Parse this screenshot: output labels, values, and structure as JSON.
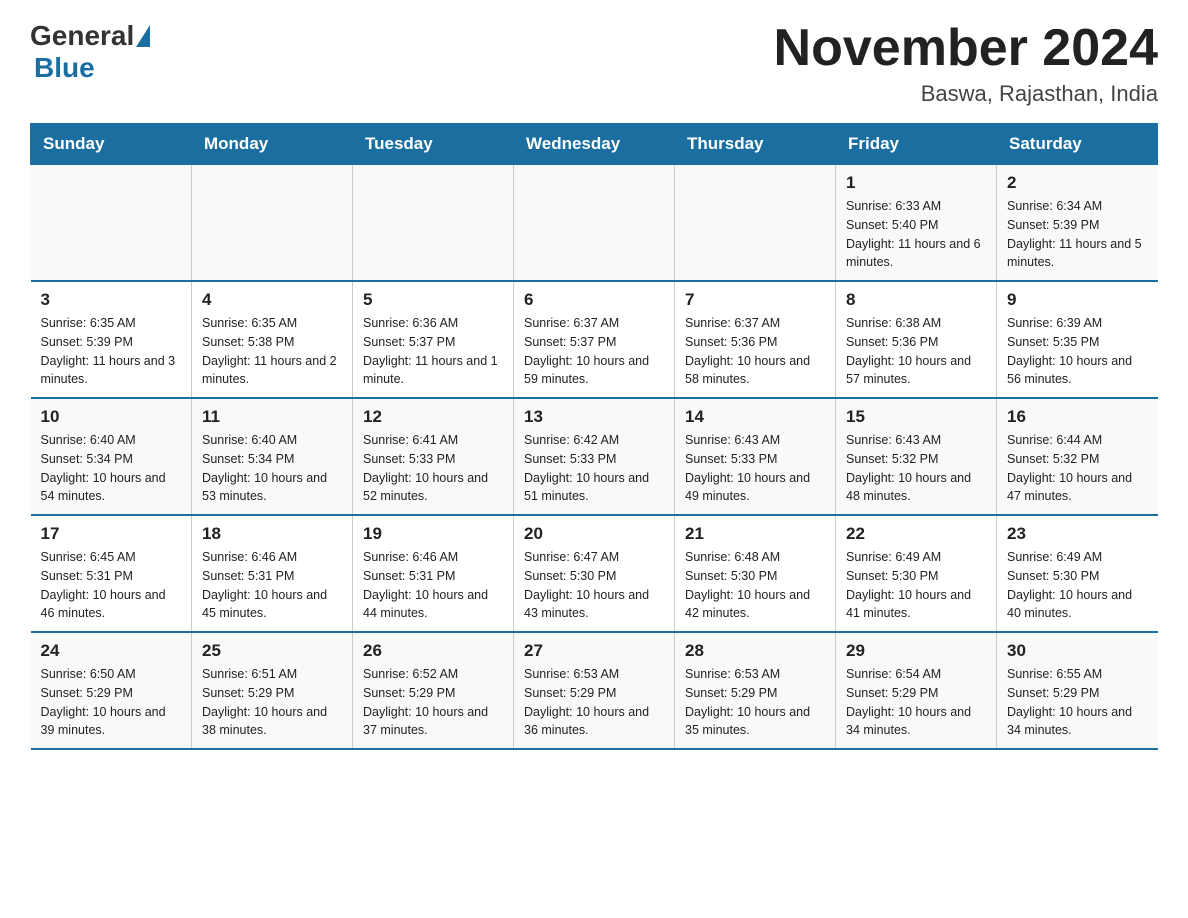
{
  "header": {
    "logo_general": "General",
    "logo_blue": "Blue",
    "month_title": "November 2024",
    "location": "Baswa, Rajasthan, India"
  },
  "calendar": {
    "days_of_week": [
      "Sunday",
      "Monday",
      "Tuesday",
      "Wednesday",
      "Thursday",
      "Friday",
      "Saturday"
    ],
    "weeks": [
      [
        {
          "day": "",
          "info": ""
        },
        {
          "day": "",
          "info": ""
        },
        {
          "day": "",
          "info": ""
        },
        {
          "day": "",
          "info": ""
        },
        {
          "day": "",
          "info": ""
        },
        {
          "day": "1",
          "info": "Sunrise: 6:33 AM\nSunset: 5:40 PM\nDaylight: 11 hours and 6 minutes."
        },
        {
          "day": "2",
          "info": "Sunrise: 6:34 AM\nSunset: 5:39 PM\nDaylight: 11 hours and 5 minutes."
        }
      ],
      [
        {
          "day": "3",
          "info": "Sunrise: 6:35 AM\nSunset: 5:39 PM\nDaylight: 11 hours and 3 minutes."
        },
        {
          "day": "4",
          "info": "Sunrise: 6:35 AM\nSunset: 5:38 PM\nDaylight: 11 hours and 2 minutes."
        },
        {
          "day": "5",
          "info": "Sunrise: 6:36 AM\nSunset: 5:37 PM\nDaylight: 11 hours and 1 minute."
        },
        {
          "day": "6",
          "info": "Sunrise: 6:37 AM\nSunset: 5:37 PM\nDaylight: 10 hours and 59 minutes."
        },
        {
          "day": "7",
          "info": "Sunrise: 6:37 AM\nSunset: 5:36 PM\nDaylight: 10 hours and 58 minutes."
        },
        {
          "day": "8",
          "info": "Sunrise: 6:38 AM\nSunset: 5:36 PM\nDaylight: 10 hours and 57 minutes."
        },
        {
          "day": "9",
          "info": "Sunrise: 6:39 AM\nSunset: 5:35 PM\nDaylight: 10 hours and 56 minutes."
        }
      ],
      [
        {
          "day": "10",
          "info": "Sunrise: 6:40 AM\nSunset: 5:34 PM\nDaylight: 10 hours and 54 minutes."
        },
        {
          "day": "11",
          "info": "Sunrise: 6:40 AM\nSunset: 5:34 PM\nDaylight: 10 hours and 53 minutes."
        },
        {
          "day": "12",
          "info": "Sunrise: 6:41 AM\nSunset: 5:33 PM\nDaylight: 10 hours and 52 minutes."
        },
        {
          "day": "13",
          "info": "Sunrise: 6:42 AM\nSunset: 5:33 PM\nDaylight: 10 hours and 51 minutes."
        },
        {
          "day": "14",
          "info": "Sunrise: 6:43 AM\nSunset: 5:33 PM\nDaylight: 10 hours and 49 minutes."
        },
        {
          "day": "15",
          "info": "Sunrise: 6:43 AM\nSunset: 5:32 PM\nDaylight: 10 hours and 48 minutes."
        },
        {
          "day": "16",
          "info": "Sunrise: 6:44 AM\nSunset: 5:32 PM\nDaylight: 10 hours and 47 minutes."
        }
      ],
      [
        {
          "day": "17",
          "info": "Sunrise: 6:45 AM\nSunset: 5:31 PM\nDaylight: 10 hours and 46 minutes."
        },
        {
          "day": "18",
          "info": "Sunrise: 6:46 AM\nSunset: 5:31 PM\nDaylight: 10 hours and 45 minutes."
        },
        {
          "day": "19",
          "info": "Sunrise: 6:46 AM\nSunset: 5:31 PM\nDaylight: 10 hours and 44 minutes."
        },
        {
          "day": "20",
          "info": "Sunrise: 6:47 AM\nSunset: 5:30 PM\nDaylight: 10 hours and 43 minutes."
        },
        {
          "day": "21",
          "info": "Sunrise: 6:48 AM\nSunset: 5:30 PM\nDaylight: 10 hours and 42 minutes."
        },
        {
          "day": "22",
          "info": "Sunrise: 6:49 AM\nSunset: 5:30 PM\nDaylight: 10 hours and 41 minutes."
        },
        {
          "day": "23",
          "info": "Sunrise: 6:49 AM\nSunset: 5:30 PM\nDaylight: 10 hours and 40 minutes."
        }
      ],
      [
        {
          "day": "24",
          "info": "Sunrise: 6:50 AM\nSunset: 5:29 PM\nDaylight: 10 hours and 39 minutes."
        },
        {
          "day": "25",
          "info": "Sunrise: 6:51 AM\nSunset: 5:29 PM\nDaylight: 10 hours and 38 minutes."
        },
        {
          "day": "26",
          "info": "Sunrise: 6:52 AM\nSunset: 5:29 PM\nDaylight: 10 hours and 37 minutes."
        },
        {
          "day": "27",
          "info": "Sunrise: 6:53 AM\nSunset: 5:29 PM\nDaylight: 10 hours and 36 minutes."
        },
        {
          "day": "28",
          "info": "Sunrise: 6:53 AM\nSunset: 5:29 PM\nDaylight: 10 hours and 35 minutes."
        },
        {
          "day": "29",
          "info": "Sunrise: 6:54 AM\nSunset: 5:29 PM\nDaylight: 10 hours and 34 minutes."
        },
        {
          "day": "30",
          "info": "Sunrise: 6:55 AM\nSunset: 5:29 PM\nDaylight: 10 hours and 34 minutes."
        }
      ]
    ]
  }
}
